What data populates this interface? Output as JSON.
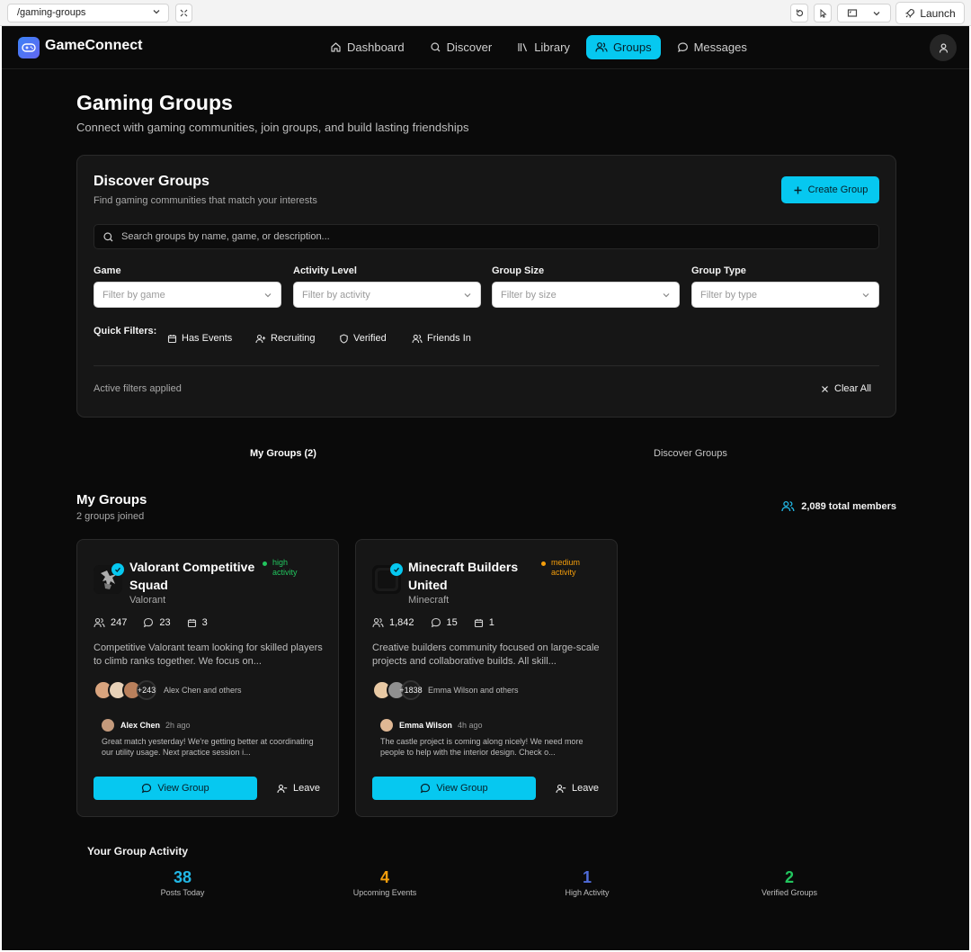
{
  "browser": {
    "url": "/gaming-groups",
    "launch_label": "Launch"
  },
  "app": {
    "name": "GameConnect",
    "nav": [
      {
        "label": "Dashboard",
        "icon": "home-icon",
        "active": false
      },
      {
        "label": "Discover",
        "icon": "search-icon",
        "active": false
      },
      {
        "label": "Library",
        "icon": "library-icon",
        "active": false
      },
      {
        "label": "Groups",
        "icon": "users-icon",
        "active": true
      },
      {
        "label": "Messages",
        "icon": "message-icon",
        "active": false
      }
    ],
    "colors": {
      "accent": "#06c8f0",
      "background": "#0a0a0a",
      "card": "#161616",
      "high": "#22c55e",
      "medium": "#f59e0b"
    }
  },
  "page": {
    "title": "Gaming Groups",
    "subtitle": "Connect with gaming communities, join groups, and build lasting friendships"
  },
  "discover": {
    "title": "Discover Groups",
    "subtitle": "Find gaming communities that match your interests",
    "create_label": "Create Group",
    "search_placeholder": "Search groups by name, game, or description...",
    "filters": [
      {
        "label": "Game",
        "placeholder": "Filter by game"
      },
      {
        "label": "Activity Level",
        "placeholder": "Filter by activity"
      },
      {
        "label": "Group Size",
        "placeholder": "Filter by size"
      },
      {
        "label": "Group Type",
        "placeholder": "Filter by type"
      }
    ],
    "quick_filters_label": "Quick Filters:",
    "quick_filters": [
      {
        "label": "Has Events",
        "icon": "calendar-icon"
      },
      {
        "label": "Recruiting",
        "icon": "user-plus-icon"
      },
      {
        "label": "Verified",
        "icon": "shield-icon"
      },
      {
        "label": "Friends In",
        "icon": "users-icon"
      }
    ],
    "active_filters_text": "Active filters applied",
    "clear_all_label": "Clear All"
  },
  "tabs": {
    "my_groups": "My Groups (2)",
    "discover_groups": "Discover Groups"
  },
  "my_groups": {
    "title": "My Groups",
    "subtitle": "2 groups joined",
    "total_members": "2,089 total members",
    "groups": [
      {
        "name": "Valorant Competitive Squad",
        "game": "Valorant",
        "activity": "high activity",
        "activity_color": "#22c55e",
        "members": "247",
        "posts": "23",
        "events": "3",
        "description": "Competitive Valorant team looking for skilled players to climb ranks together. We focus on...",
        "extra_members": "+243",
        "members_text": "Alex Chen and others",
        "post_author": "Alex Chen",
        "post_time": "2h ago",
        "post_body": "Great match yesterday! We're getting better at coordinating our utility usage. Next practice session i...",
        "view_label": "View Group",
        "leave_label": "Leave"
      },
      {
        "name": "Minecraft Builders United",
        "game": "Minecraft",
        "activity": "medium activity",
        "activity_color": "#f59e0b",
        "members": "1,842",
        "posts": "15",
        "events": "1",
        "description": "Creative builders community focused on large-scale projects and collaborative builds. All skill...",
        "extra_members": "+1838",
        "members_text": "Emma Wilson and others",
        "post_author": "Emma Wilson",
        "post_time": "4h ago",
        "post_body": "The castle project is coming along nicely! We need more people to help with the interior design. Check o...",
        "view_label": "View Group",
        "leave_label": "Leave"
      }
    ]
  },
  "activity": {
    "title": "Your Group Activity",
    "stats": [
      {
        "value": "38",
        "label": "Posts Today",
        "color": "#22b8e6"
      },
      {
        "value": "4",
        "label": "Upcoming Events",
        "color": "#f59e0b"
      },
      {
        "value": "1",
        "label": "High Activity",
        "color": "#4f6bd8"
      },
      {
        "value": "2",
        "label": "Verified Groups",
        "color": "#22c55e"
      }
    ]
  }
}
